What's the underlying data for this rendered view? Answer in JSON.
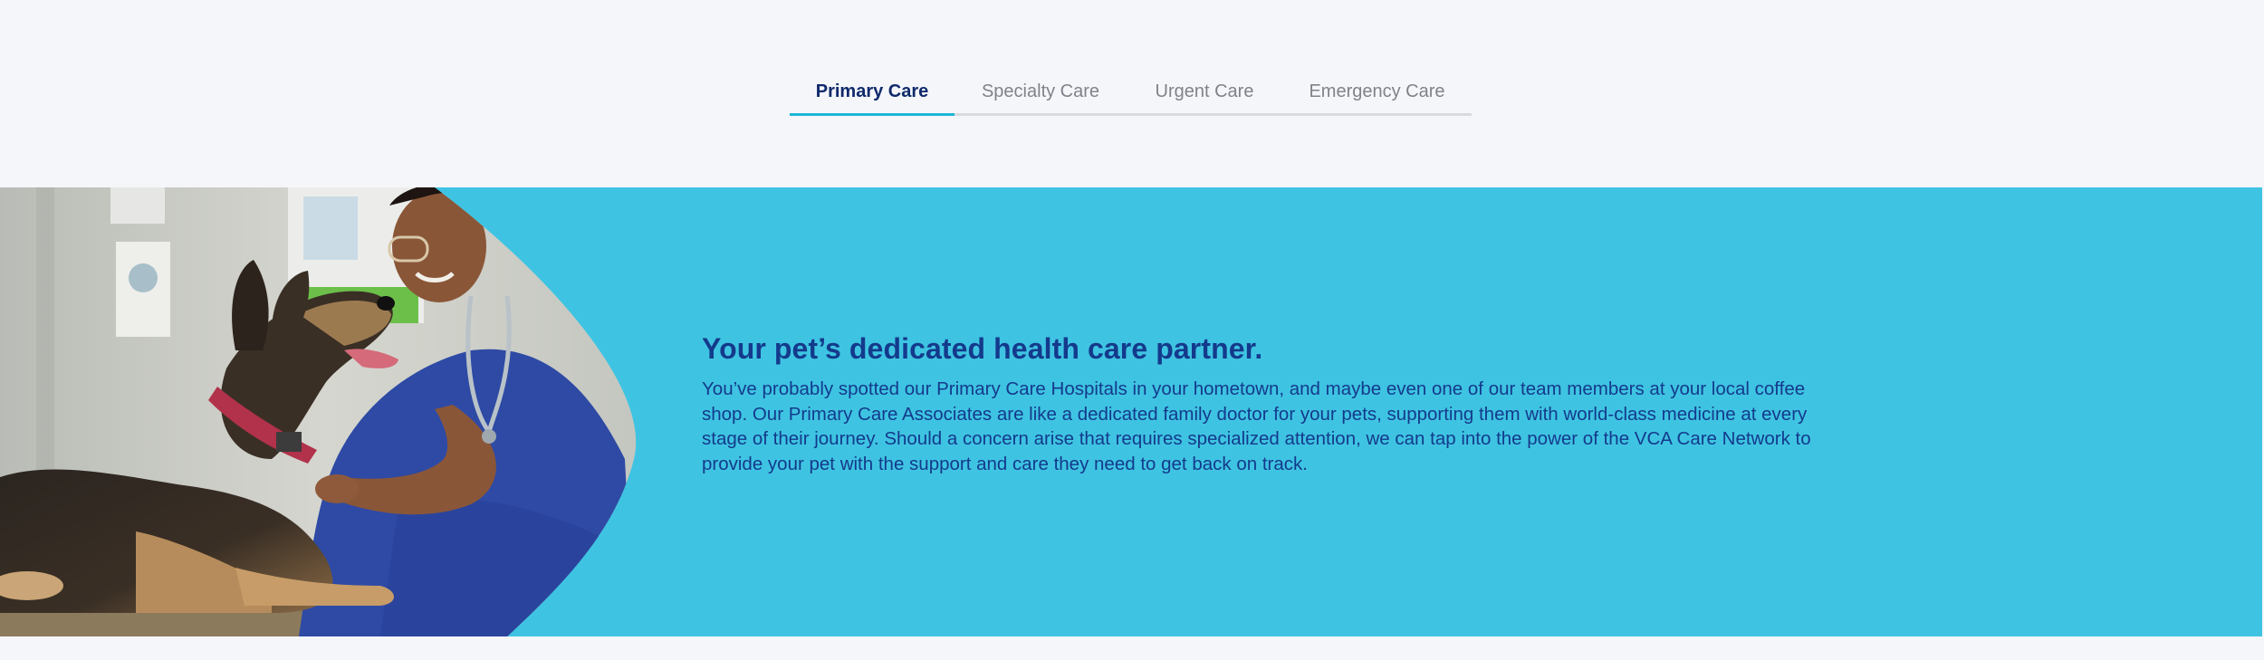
{
  "tabs": [
    {
      "label": "Primary Care",
      "active": true
    },
    {
      "label": "Specialty Care",
      "active": false
    },
    {
      "label": "Urgent Care",
      "active": false
    },
    {
      "label": "Emergency Care",
      "active": false
    }
  ],
  "hero": {
    "headline": "Your pet’s dedicated health care partner.",
    "body": "You’ve probably spotted our Primary Care Hospitals in your hometown, and maybe even one of our team members at your local coffee shop. Our Primary Care Associates are like a dedicated family doctor for your pets, supporting them with world-class medicine at every stage of their journey. Should a concern arise that requires specialized attention, we can tap into the power of the VCA Care Network to provide your pet with the support and care they need to get back on track.",
    "image_subject": "veterinarian-with-german-shepherd-photo"
  },
  "colors": {
    "accent": "#1bb7d7",
    "hero_bg": "#3ec4e2",
    "heading": "#143a8c",
    "tab_active": "#0f2a6b",
    "tab_inactive": "#7f8289",
    "page_bg": "#f5f6fa"
  }
}
